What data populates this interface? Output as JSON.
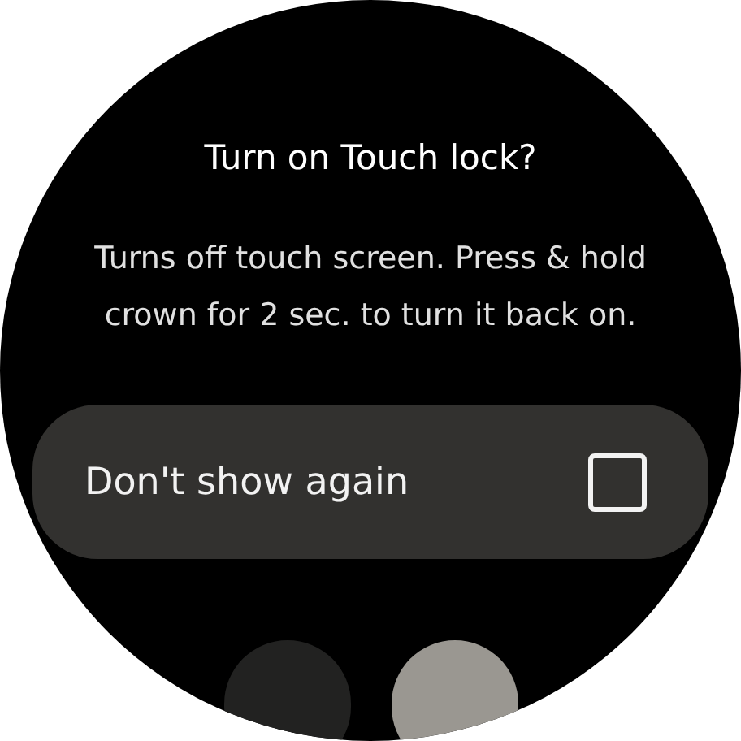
{
  "dialog": {
    "title": "Turn on Touch lock?",
    "body": "Turns off touch screen. Press & hold crown for 2 sec. to turn it back on.",
    "option": {
      "label": "Don't show again",
      "checked": false
    }
  },
  "buttons": [
    {
      "kind": "secondary"
    },
    {
      "kind": "primary"
    }
  ]
}
